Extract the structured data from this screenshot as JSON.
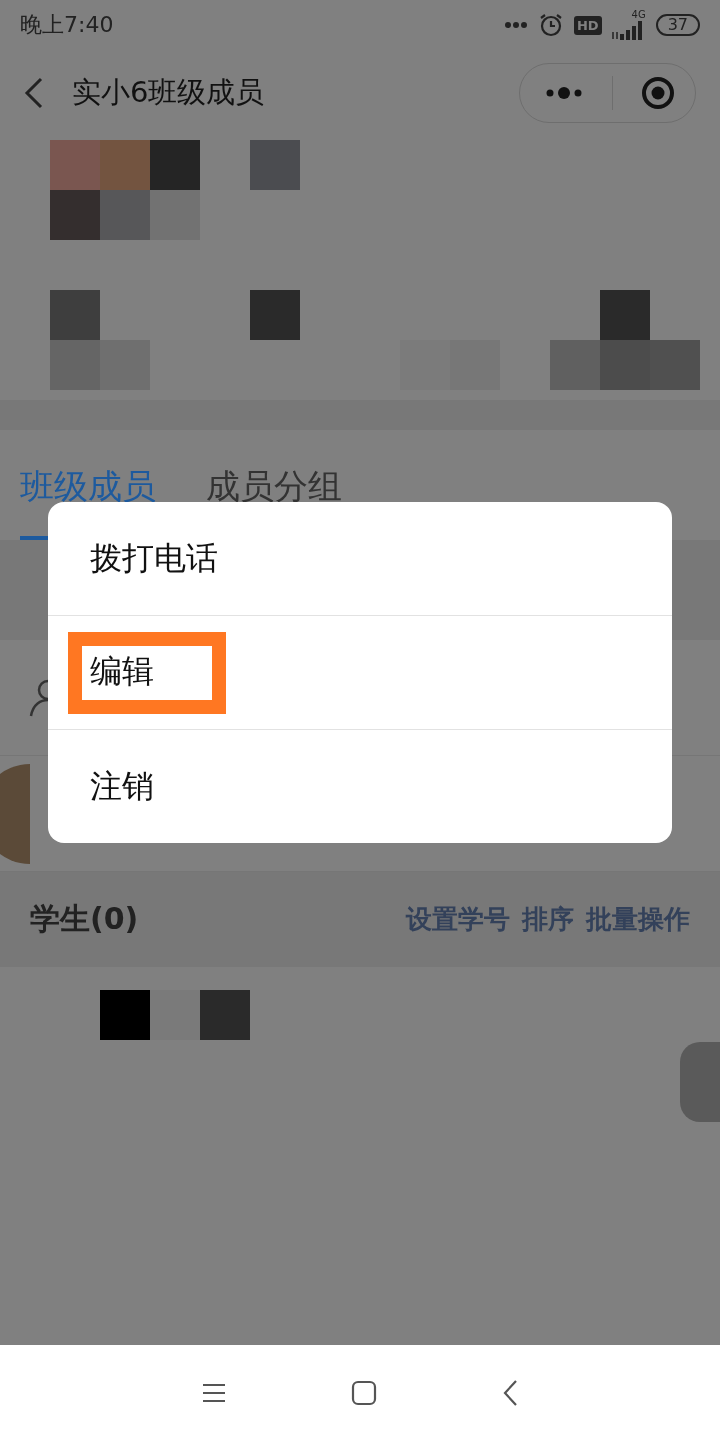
{
  "status_bar": {
    "time": "晚上7:40",
    "hd": "HD",
    "network": "4G",
    "battery": "37"
  },
  "header": {
    "title": "实小6班级成员"
  },
  "tabs": [
    {
      "label": "班级成员",
      "selected": true
    },
    {
      "label": "成员分组",
      "selected": false
    }
  ],
  "students_section": {
    "title": "学生(0)",
    "actions": [
      "设置学号",
      "排序",
      "批量操作"
    ]
  },
  "menu": {
    "items": [
      {
        "label": "拨打电话",
        "highlighted": false
      },
      {
        "label": "编辑",
        "highlighted": true
      },
      {
        "label": "注销",
        "highlighted": false
      }
    ]
  }
}
